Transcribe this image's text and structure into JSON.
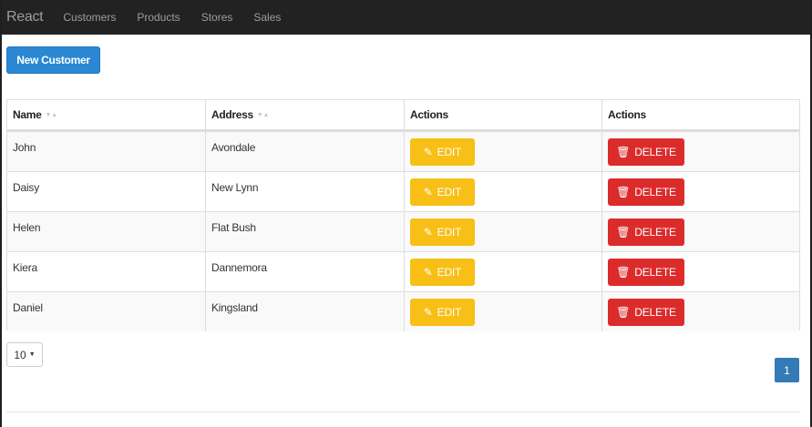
{
  "navbar": {
    "brand": "React",
    "links": [
      "Customers",
      "Products",
      "Stores",
      "Sales"
    ]
  },
  "toolbar": {
    "new_customer_label": "New Customer"
  },
  "table": {
    "columns": [
      "Name",
      "Address",
      "Actions",
      "Actions"
    ],
    "rows": [
      {
        "name": "John",
        "address": "Avondale"
      },
      {
        "name": "Daisy",
        "address": "New Lynn"
      },
      {
        "name": "Helen",
        "address": "Flat Bush"
      },
      {
        "name": "Kiera",
        "address": "Dannemora"
      },
      {
        "name": "Daniel",
        "address": "Kingsland"
      }
    ],
    "edit_label": "EDIT",
    "delete_label": "DELETE"
  },
  "pagination": {
    "page_size": "10",
    "current_page": "1"
  },
  "icons": {
    "sort": "sort-icon",
    "edit": "edit-icon",
    "delete": "trash-icon",
    "caret": "caret-down-icon"
  },
  "colors": {
    "navbar": "#222222",
    "primary": "#2b87d1",
    "edit": "#f8bf16",
    "delete": "#dc2b2b",
    "page": "#337ab7"
  }
}
